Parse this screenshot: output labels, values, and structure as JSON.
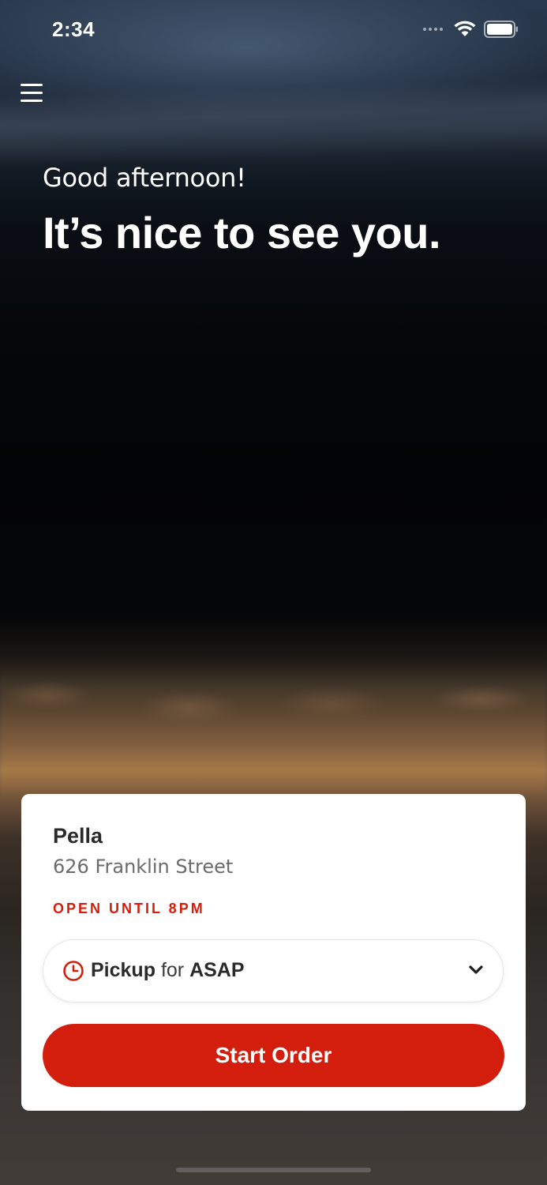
{
  "status_bar": {
    "time": "2:34",
    "icons": [
      "signal-icon",
      "wifi-icon",
      "battery-icon"
    ]
  },
  "header": {
    "menu_icon": "hamburger-menu-icon"
  },
  "hero": {
    "greeting": "Good afternoon!",
    "headline": "It’s nice to see you."
  },
  "store": {
    "name": "Pella",
    "address": "626 Franklin Street",
    "hours": "OPEN UNTIL 8PM",
    "order_mode": "Pickup",
    "order_connector": "for",
    "order_time": "ASAP",
    "start_label": "Start Order"
  },
  "colors": {
    "accent": "#d41e0d",
    "card": "#ffffff",
    "text_dark": "#2a2a2a",
    "text_muted": "#6b6b6b"
  }
}
